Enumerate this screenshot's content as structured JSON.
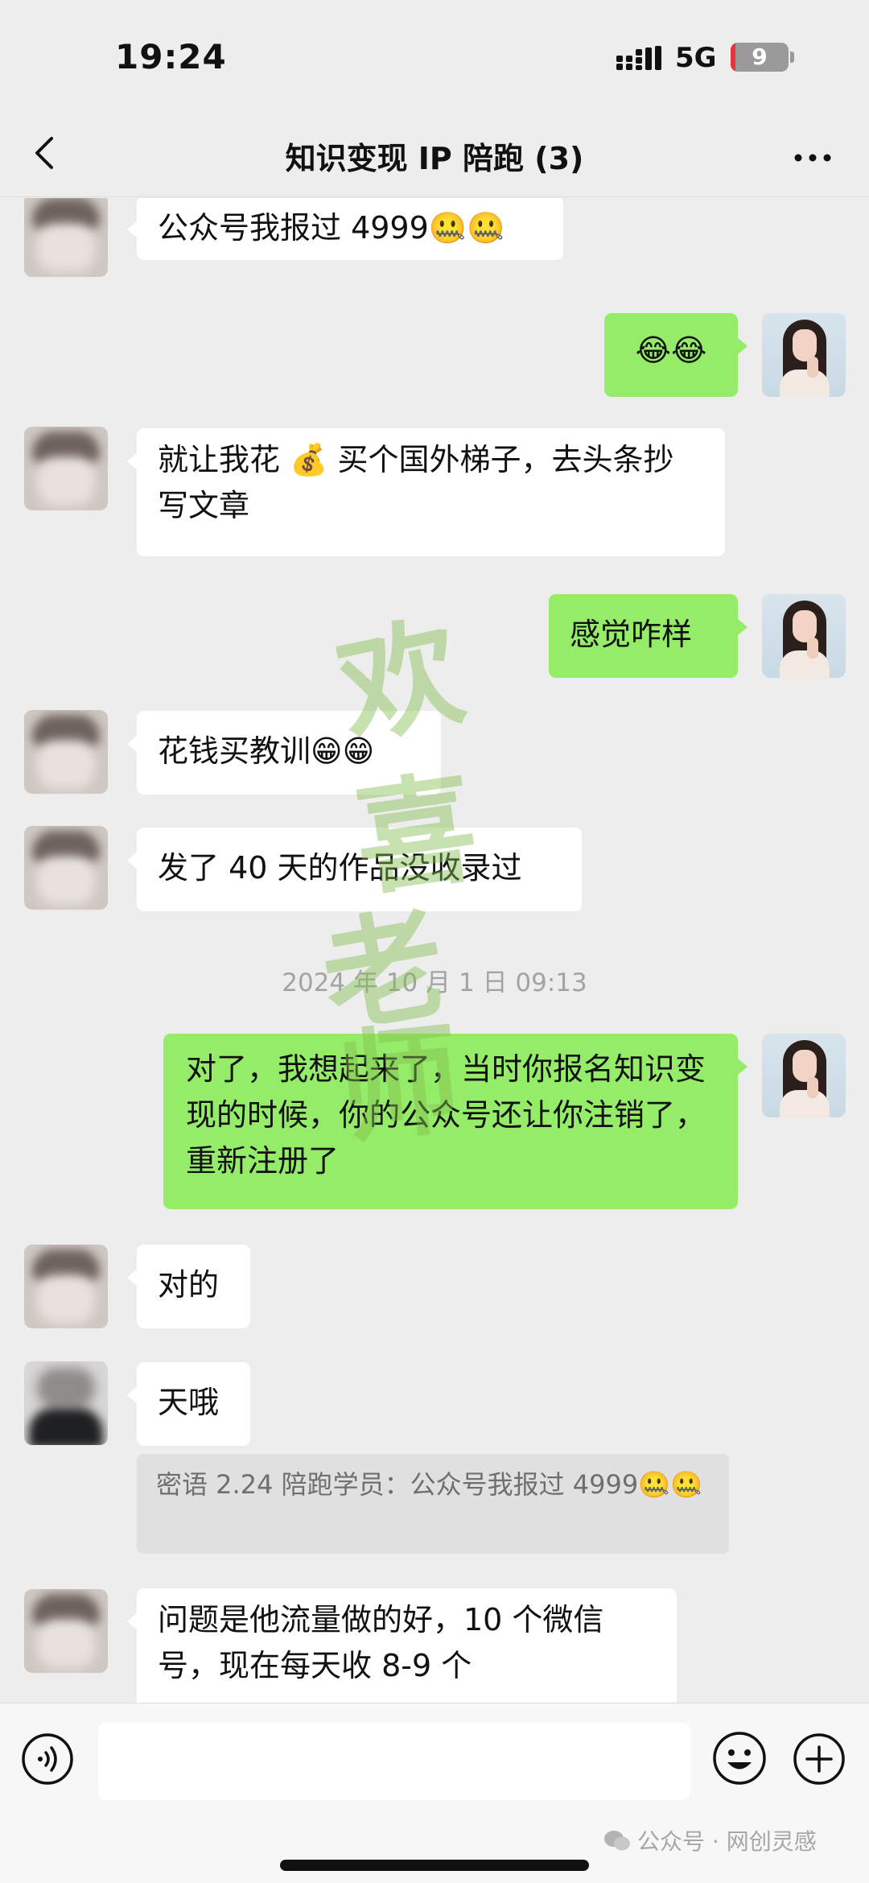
{
  "status": {
    "time": "19:24",
    "network": "5G",
    "battery": "9",
    "battery_level": 0.09
  },
  "nav": {
    "title": "知识变现 IP 陪跑 (3)"
  },
  "watermark": [
    "欢",
    "喜",
    "老",
    "师"
  ],
  "messages": [
    {
      "side": "in",
      "text": "公众号我报过 4999",
      "emoji": "🤐🤐"
    },
    {
      "side": "out",
      "text": "",
      "emoji": "😂😂"
    },
    {
      "side": "in",
      "text_before": "就让我花 ",
      "icon": "💰",
      "text_after": " 买个国外梯子，去头条抄写文章"
    },
    {
      "side": "out",
      "text": "感觉咋样"
    },
    {
      "side": "in",
      "text": "花钱买教训",
      "emoji": "😁😁"
    },
    {
      "side": "in",
      "text": "发了 40 天的作品没收录过"
    },
    {
      "side": "time",
      "text": "2024 年 10 月 1 日 09:13"
    },
    {
      "side": "out",
      "text": "对了，我想起来了，当时你报名知识变现的时候，你的公众号还让你注销了，重新注册了"
    },
    {
      "side": "in",
      "text": "对的"
    },
    {
      "side": "in",
      "text": "天哦",
      "quote_prefix": "密语 2.24 陪跑学员：",
      "quote_text": "公众号我报过 4999",
      "quote_emoji": "🤐🤐"
    },
    {
      "side": "in",
      "text": "问题是他流量做的好，10 个微信号，现在每天收 8-9 个"
    }
  ],
  "input": {
    "placeholder": ""
  },
  "footer": {
    "account": "公众号 · 网创灵感"
  },
  "colors": {
    "background": "#ededed",
    "incoming_bubble": "#ffffff",
    "outgoing_bubble": "#95ec69",
    "quote": "#e0e0e0"
  },
  "icons": [
    "back-arrow-icon",
    "more-icon",
    "voice-icon",
    "emoji-icon",
    "plus-icon",
    "wechat-icon"
  ]
}
